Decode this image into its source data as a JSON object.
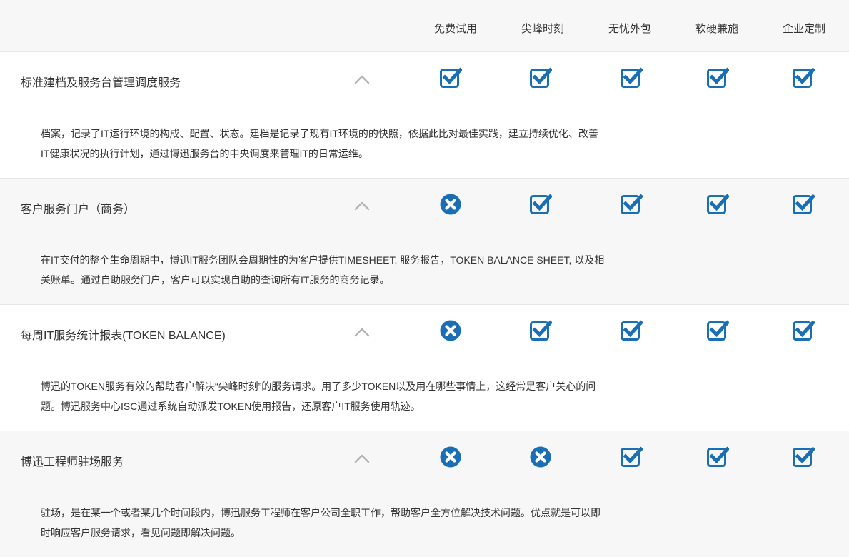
{
  "header": {
    "columns": [
      "免费试用",
      "尖峰时刻",
      "无忧外包",
      "软硬兼施",
      "企业定制"
    ]
  },
  "colors": {
    "brand_blue": "#1a6fb4",
    "chevron_gray": "#b3b3b3",
    "header_bg": "#f7f7f7"
  },
  "sections": [
    {
      "title": "标准建档及服务台管理调度服务",
      "description": "档案，记录了IT运行环境的构成、配置、状态。建档是记录了现有IT环境的的快照，依据此比对最佳实践，建立持续优化、改善IT健康状况的执行计划，通过博迅服务台的中央调度来管理IT的日常运维。",
      "marks": [
        "check",
        "check",
        "check",
        "check",
        "check"
      ]
    },
    {
      "title": "客户服务门户（商务）",
      "description": "在IT交付的整个生命周期中，博迅IT服务团队会周期性的为客户提供TIMESHEET, 服务报告，TOKEN BALANCE SHEET, 以及相关账单。通过自助服务门户，客户可以实现自助的查询所有IT服务的商务记录。",
      "marks": [
        "cross",
        "check",
        "check",
        "check",
        "check"
      ]
    },
    {
      "title": "每周IT服务统计报表(TOKEN BALANCE)",
      "description": "博迅的TOKEN服务有效的帮助客户解决“尖峰时刻”的服务请求。用了多少TOKEN以及用在哪些事情上，这经常是客户关心的问题。博迅服务中心ISC通过系统自动派发TOKEN使用报告，还原客户IT服务使用轨迹。",
      "marks": [
        "cross",
        "check",
        "check",
        "check",
        "check"
      ]
    },
    {
      "title": "博迅工程师驻场服务",
      "description": "驻场，是在某一个或者某几个时间段内，博迅服务工程师在客户公司全职工作，帮助客户全方位解决技术问题。优点就是可以即时响应客户服务请求，看见问题即解决问题。",
      "marks": [
        "cross",
        "cross",
        "check",
        "check",
        "check"
      ]
    }
  ]
}
